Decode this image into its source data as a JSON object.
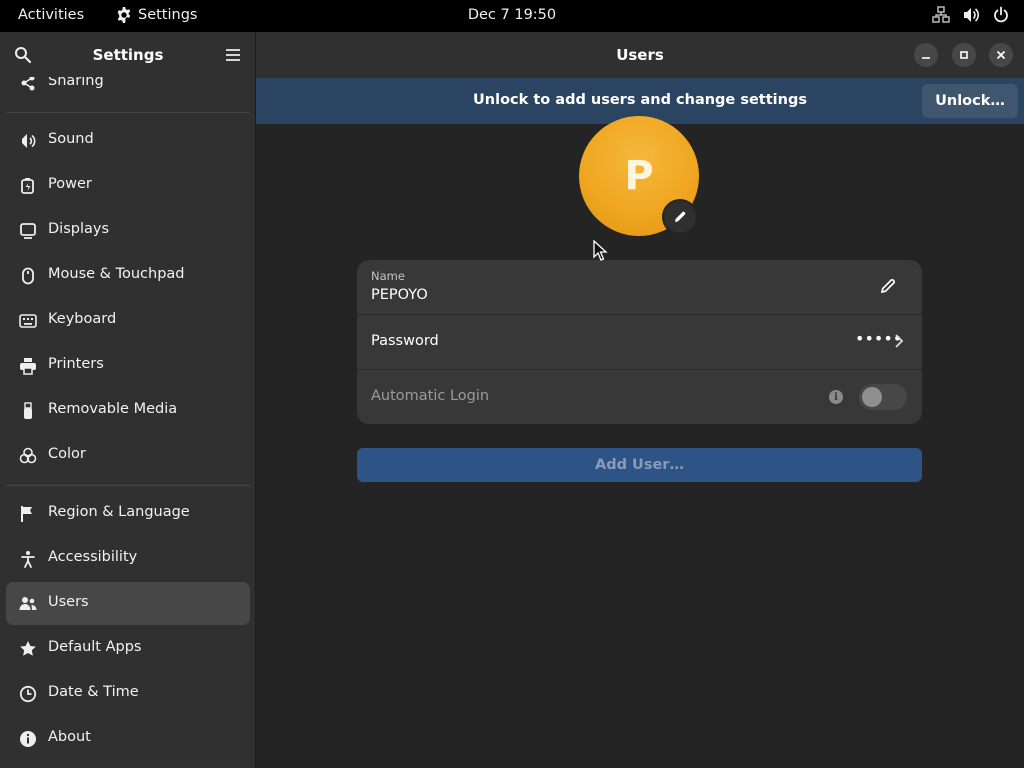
{
  "topbar": {
    "activities": "Activities",
    "app_name": "Settings",
    "clock": "Dec 7  19:50"
  },
  "sidebar": {
    "title": "Settings",
    "items": [
      {
        "label": "Sharing",
        "icon": "share-icon"
      },
      {
        "label": "Sound",
        "icon": "speaker-icon"
      },
      {
        "label": "Power",
        "icon": "battery-icon"
      },
      {
        "label": "Displays",
        "icon": "monitor-icon"
      },
      {
        "label": "Mouse & Touchpad",
        "icon": "mouse-icon"
      },
      {
        "label": "Keyboard",
        "icon": "keyboard-icon"
      },
      {
        "label": "Printers",
        "icon": "printer-icon"
      },
      {
        "label": "Removable Media",
        "icon": "usb-icon"
      },
      {
        "label": "Color",
        "icon": "color-icon"
      },
      {
        "label": "Region & Language",
        "icon": "flag-icon"
      },
      {
        "label": "Accessibility",
        "icon": "accessibility-icon"
      },
      {
        "label": "Users",
        "icon": "users-icon"
      },
      {
        "label": "Default Apps",
        "icon": "star-icon"
      },
      {
        "label": "Date & Time",
        "icon": "clock-icon"
      },
      {
        "label": "About",
        "icon": "info-icon"
      }
    ],
    "active": "Users"
  },
  "main": {
    "title": "Users",
    "banner_text": "Unlock to add users and change settings",
    "unlock_label": "Unlock…",
    "avatar_initial": "P",
    "name_caption": "Name",
    "name_value": "PEPOYO",
    "password_label": "Password",
    "password_mask": "•••••",
    "autologin_label": "Automatic Login",
    "autologin_enabled": false,
    "add_user_label": "Add User…"
  },
  "colors": {
    "banner": "#2b4462",
    "accent": "#2e5487",
    "avatar": "#f0a722"
  }
}
